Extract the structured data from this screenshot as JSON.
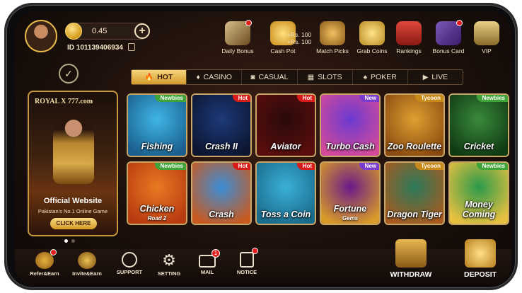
{
  "player": {
    "balance": "0.45",
    "uid": "ID  101139406934"
  },
  "top_icons": [
    {
      "label": "Daily Bonus",
      "color": "#a07a3a"
    },
    {
      "label": "Cash Pot",
      "color": "#d8a428"
    },
    {
      "label": "Match Picks",
      "color": "#b58a30"
    },
    {
      "label": "Grab Coins",
      "color": "#d9b03a"
    },
    {
      "label": "Rankings",
      "color": "#c73a2a"
    },
    {
      "label": "Bonus Card",
      "color": "#5a3a8a"
    },
    {
      "label": "VIP",
      "color": "#c8aa58"
    }
  ],
  "cash_pot_note": {
    "line1": "+Rs. 100",
    "line2": "+Rs. 100"
  },
  "tabs": [
    {
      "label": "HOT",
      "icon": "flame-icon",
      "active": true
    },
    {
      "label": "CASINO",
      "icon": "casino-icon",
      "active": false
    },
    {
      "label": "CASUAL",
      "icon": "gamepad-icon",
      "active": false
    },
    {
      "label": "SLOTS",
      "icon": "slots-icon",
      "active": false
    },
    {
      "label": "POKER",
      "icon": "poker-icon",
      "active": false
    },
    {
      "label": "LIVE",
      "icon": "live-icon",
      "active": false
    }
  ],
  "banner": {
    "brand": "ROYAL X 777.com",
    "title": "Official Website",
    "subtitle": "Pakistan's No.1 Online Game",
    "button": "CLICK HERE"
  },
  "games": [
    {
      "name": "Fishing",
      "tag": "Newbies",
      "c1": "#3fb6e6",
      "c2": "#1a5f8e"
    },
    {
      "name": "Crash II",
      "tag": "Hot",
      "c1": "#1e3a7a",
      "c2": "#0b1530"
    },
    {
      "name": "Aviator",
      "tag": "Hot",
      "c1": "#2a0a0a",
      "c2": "#5a0d0d"
    },
    {
      "name": "Turbo Cash",
      "tag": "New",
      "c1": "#6a3ad1",
      "c2": "#d44a9a"
    },
    {
      "name": "Zoo Roulette",
      "tag": "Tycoon",
      "c1": "#e0a030",
      "c2": "#8a4a10"
    },
    {
      "name": "Cricket",
      "tag": "Newbies",
      "c1": "#3a8a3a",
      "c2": "#0f3a14"
    },
    {
      "name": "Chicken",
      "sub": "Road 2",
      "tag": "Newbies",
      "c1": "#e87a22",
      "c2": "#b83a10"
    },
    {
      "name": "Crash",
      "tag": "Hot",
      "c1": "#3a8ed8",
      "c2": "#c85a20"
    },
    {
      "name": "Toss a Coin",
      "tag": "Hot",
      "c1": "#3ab0d8",
      "c2": "#1a6a8a"
    },
    {
      "name": "Fortune",
      "sub": "Gems",
      "tag": "New",
      "c1": "#6a1a8a",
      "c2": "#d89a28"
    },
    {
      "name": "Dragon Tiger",
      "tag": "Tycoon",
      "c1": "#2a7a5a",
      "c2": "#a85a20"
    },
    {
      "name": "Money Coming",
      "tag": "Newbies",
      "c1": "#2a9a4a",
      "c2": "#e8c040"
    }
  ],
  "bottom_nav": [
    {
      "label": "Refer&Earn",
      "badge": ""
    },
    {
      "label": "Invite&Earn",
      "badge": ""
    },
    {
      "label": "SUPPORT",
      "badge": ""
    },
    {
      "label": "SETTING",
      "badge": ""
    },
    {
      "label": "MAIL",
      "badge": "1"
    },
    {
      "label": "NOTICE",
      "badge": ""
    }
  ],
  "withdraw": "WITHDRAW",
  "deposit": "DEPOSIT"
}
